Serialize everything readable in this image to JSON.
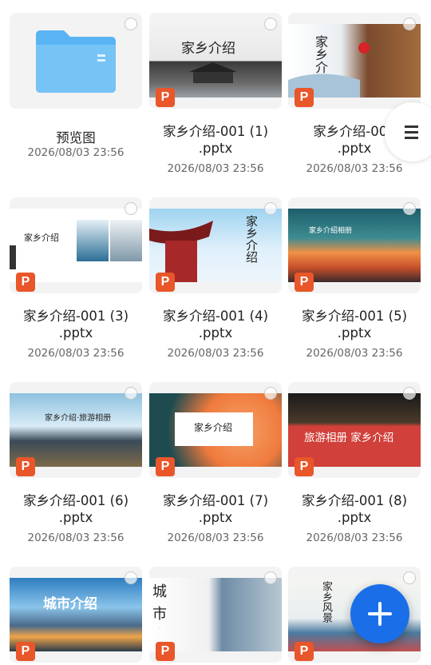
{
  "files": [
    {
      "name": "预览图",
      "date": "2026/08/03 23:56",
      "type": "folder"
    },
    {
      "name": "家乡介绍-001 (1)\n.pptx",
      "date": "2026/08/03 23:56",
      "type": "pptx",
      "slide_text": "家乡介绍"
    },
    {
      "name": "家乡介绍-001\n.pptx",
      "date": "2026/08/03 23:56",
      "type": "pptx",
      "slide_text": "家乡介绍"
    },
    {
      "name": "家乡介绍-001 (3)\n.pptx",
      "date": "2026/08/03 23:56",
      "type": "pptx",
      "slide_text": "家乡介绍"
    },
    {
      "name": "家乡介绍-001 (4)\n.pptx",
      "date": "2026/08/03 23:56",
      "type": "pptx",
      "slide_text": "家乡介绍"
    },
    {
      "name": "家乡介绍-001 (5)\n.pptx",
      "date": "2026/08/03 23:56",
      "type": "pptx",
      "slide_text": "家乡介绍相册"
    },
    {
      "name": "家乡介绍-001 (6)\n.pptx",
      "date": "2026/08/03 23:56",
      "type": "pptx",
      "slide_text": "家乡介绍·旅游相册"
    },
    {
      "name": "家乡介绍-001 (7)\n.pptx",
      "date": "2026/08/03 23:56",
      "type": "pptx",
      "slide_text": "家乡介绍"
    },
    {
      "name": "家乡介绍-001 (8)\n.pptx",
      "date": "2026/08/03 23:56",
      "type": "pptx",
      "slide_text": "旅游相册 家乡介绍"
    },
    {
      "name": "",
      "date": "",
      "type": "pptx",
      "slide_text": "城市介绍"
    },
    {
      "name": "",
      "date": "",
      "type": "pptx",
      "slide_text": "城市介绍通用模板"
    },
    {
      "name": "",
      "date": "",
      "type": "pptx",
      "slide_text": "家乡风景"
    }
  ],
  "labels": {
    "ppt_badge": "P"
  },
  "icons": {
    "fab": "plus-icon",
    "menu": "menu-icon",
    "folder": "folder-icon"
  },
  "colors": {
    "accent": "#1a6fe8",
    "ppt": "#e8562a",
    "folder": "#4aa8f0"
  }
}
